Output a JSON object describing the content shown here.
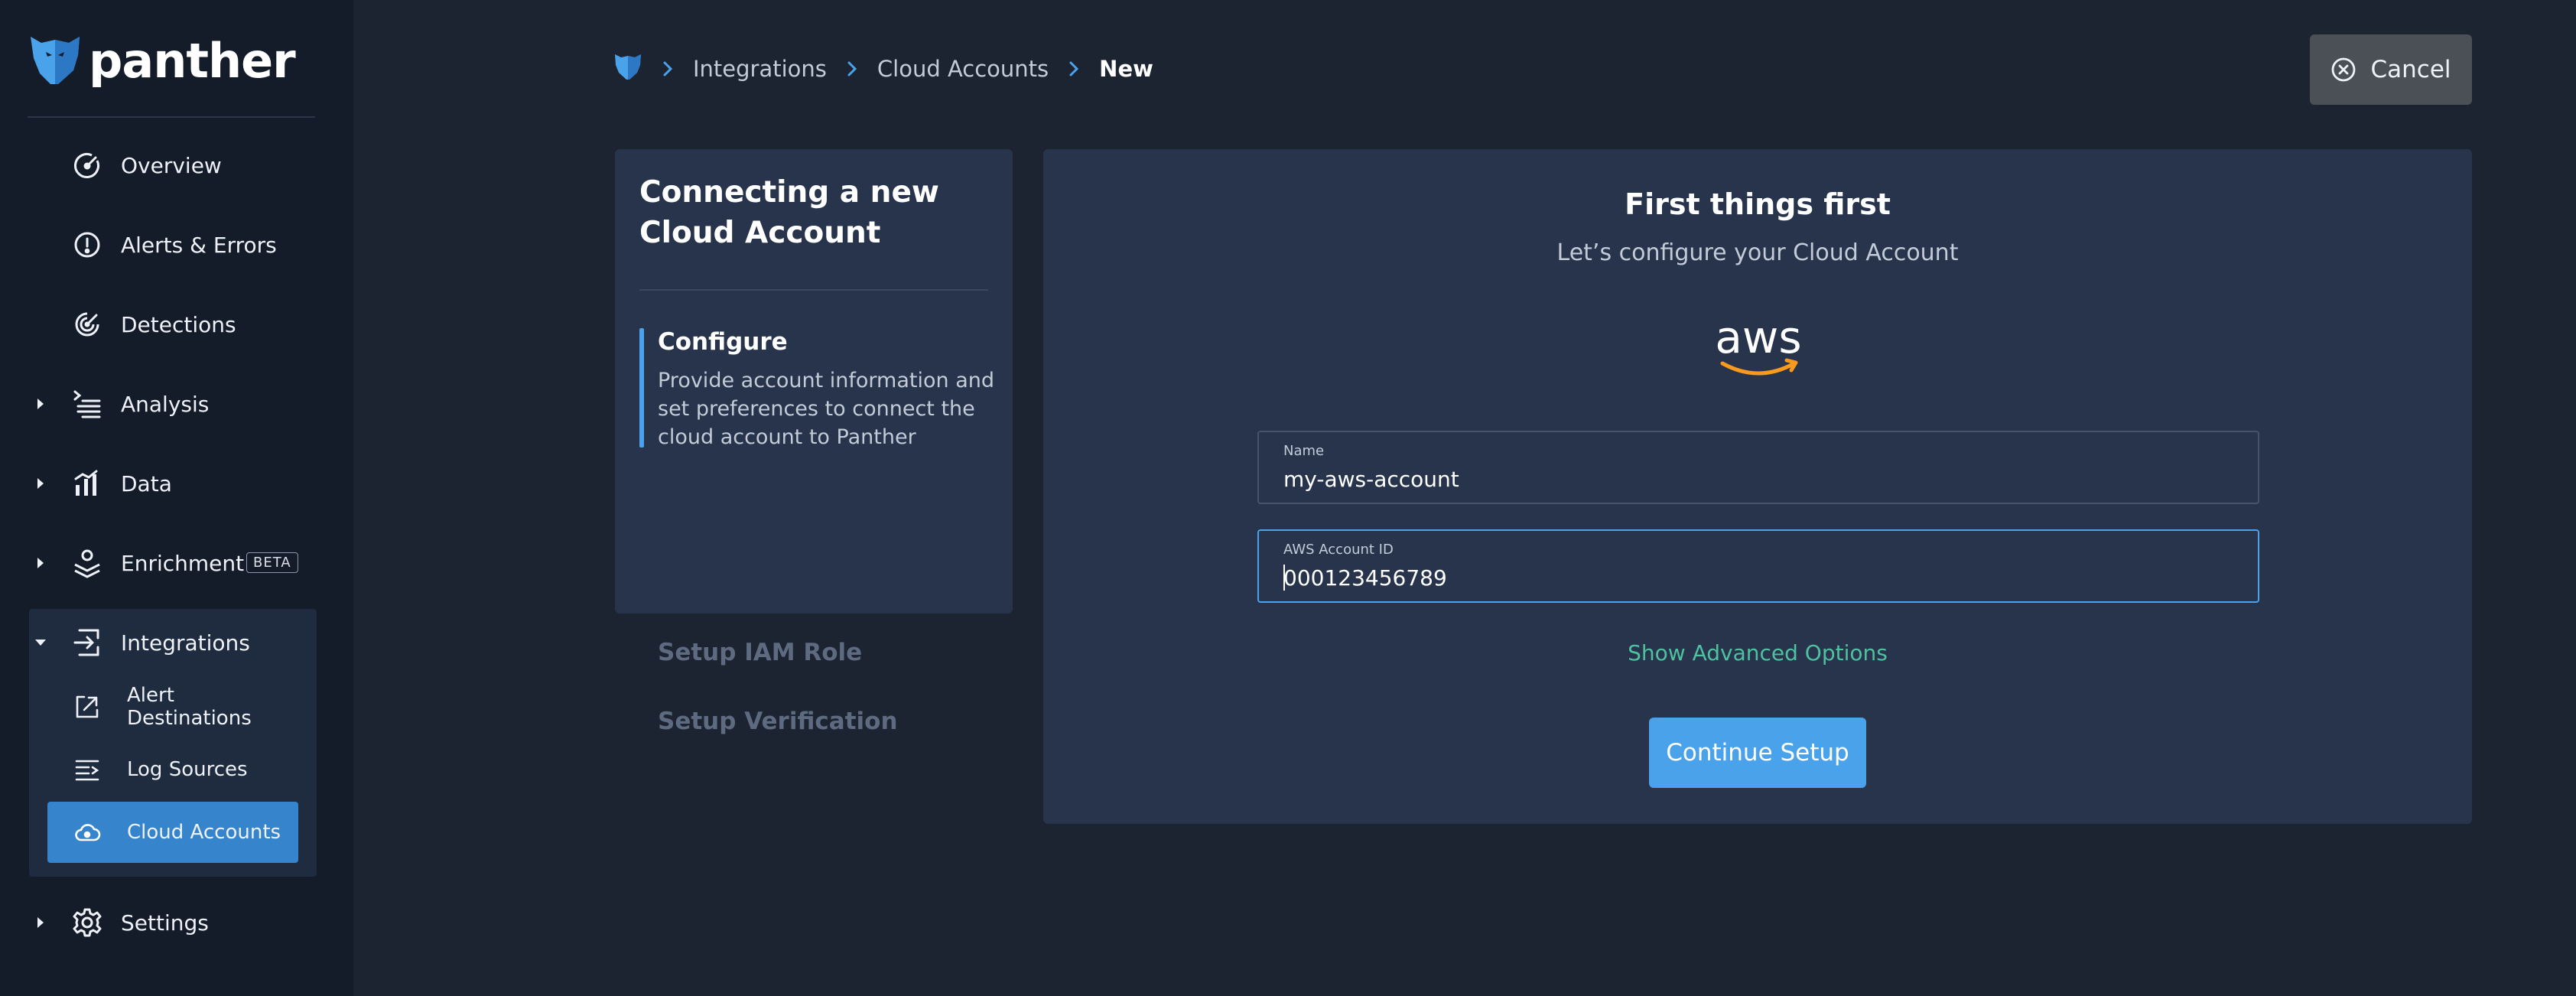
{
  "brand": {
    "name": "panther",
    "logo_icon": "panther-logo-icon"
  },
  "sidebar": {
    "items": [
      {
        "label": "Overview",
        "icon": "gauge-icon",
        "expandable": false
      },
      {
        "label": "Alerts & Errors",
        "icon": "alert-circle-icon",
        "expandable": false
      },
      {
        "label": "Detections",
        "icon": "radar-icon",
        "expandable": false
      },
      {
        "label": "Analysis",
        "icon": "terminal-list-icon",
        "expandable": true
      },
      {
        "label": "Data",
        "icon": "bar-chart-icon",
        "expandable": true
      },
      {
        "label": "Enrichment",
        "icon": "stack-layers-icon",
        "expandable": true,
        "badge": "BETA"
      },
      {
        "label": "Integrations",
        "icon": "integrations-icon",
        "expandable": true,
        "expanded": true
      },
      {
        "label": "Settings",
        "icon": "gear-icon",
        "expandable": true
      }
    ],
    "integrations_children": [
      {
        "label": "Alert Destinations",
        "icon": "share-out-icon"
      },
      {
        "label": "Log Sources",
        "icon": "log-list-icon"
      },
      {
        "label": "Cloud Accounts",
        "icon": "cloud-icon",
        "active": true
      }
    ]
  },
  "breadcrumb": {
    "home_icon": "panther-shield-icon",
    "items": [
      "Integrations",
      "Cloud Accounts",
      "New"
    ]
  },
  "header": {
    "cancel_label": "Cancel",
    "cancel_icon": "close-circle-icon"
  },
  "steps": {
    "title": "Connecting a new Cloud Account",
    "items": [
      {
        "title": "Configure",
        "description": "Provide account information and set preferences to connect the cloud account to Panther",
        "active": true
      },
      {
        "title": "Setup IAM Role",
        "active": false
      },
      {
        "title": "Setup Verification",
        "active": false
      }
    ]
  },
  "form": {
    "heading": "First things first",
    "subheading": "Let’s configure your Cloud Account",
    "provider_logo": "aws-logo",
    "fields": [
      {
        "label": "Name",
        "value": "my-aws-account",
        "focused": false
      },
      {
        "label": "AWS Account ID",
        "value": "000123456789",
        "focused": true
      }
    ],
    "advanced_label": "Show Advanced Options",
    "submit_label": "Continue Setup"
  },
  "colors": {
    "background": "#1c2331",
    "sidebar": "#151c29",
    "panel": "#27344b",
    "accent_blue": "#4aa3ea",
    "active_nav": "#3584cc",
    "link_green": "#4fc1a0",
    "cancel_button": "#4b4f56"
  }
}
